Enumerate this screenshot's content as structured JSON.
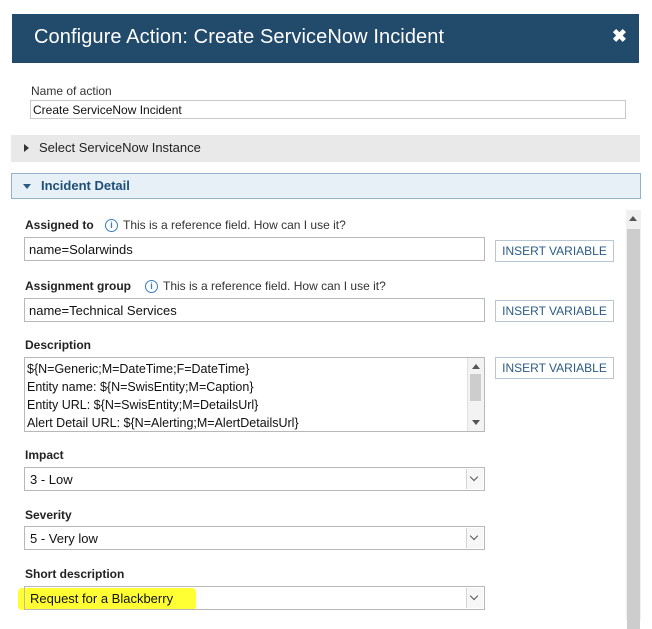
{
  "dialog": {
    "title": "Configure Action: Create ServiceNow Incident",
    "close_symbol": "✖"
  },
  "name_of_action": {
    "label": "Name of action",
    "value": "Create ServiceNow Incident"
  },
  "sections": {
    "instance": {
      "label": "Select ServiceNow Instance",
      "state": "collapsed"
    },
    "incident": {
      "label": "Incident Detail",
      "state": "expanded"
    }
  },
  "reference_info": {
    "text": "This is a reference field.",
    "help": "How can I use it?",
    "icon": "info-icon"
  },
  "fields": {
    "assigned_to": {
      "label": "Assigned to",
      "value": "name=Solarwinds",
      "button": "INSERT VARIABLE"
    },
    "assignment_group": {
      "label": "Assignment group",
      "value": "name=Technical Services",
      "button": "INSERT VARIABLE"
    },
    "description": {
      "label": "Description",
      "lines": [
        "${N=Generic;M=DateTime;F=DateTime}",
        "Entity name: ${N=SwisEntity;M=Caption}",
        "Entity URL: ${N=SwisEntity;M=DetailsUrl}",
        "Alert Detail URL: ${N=Alerting;M=AlertDetailsUrl}"
      ],
      "button": "INSERT VARIABLE"
    },
    "impact": {
      "label": "Impact",
      "value": "3 - Low"
    },
    "severity": {
      "label": "Severity",
      "value": "5 - Very low"
    },
    "short_description": {
      "label": "Short description",
      "value": "Request for a Blackberry"
    }
  },
  "colors": {
    "titlebar": "#224a6b",
    "accent": "#2b5b85",
    "highlight": "#ffff33"
  }
}
